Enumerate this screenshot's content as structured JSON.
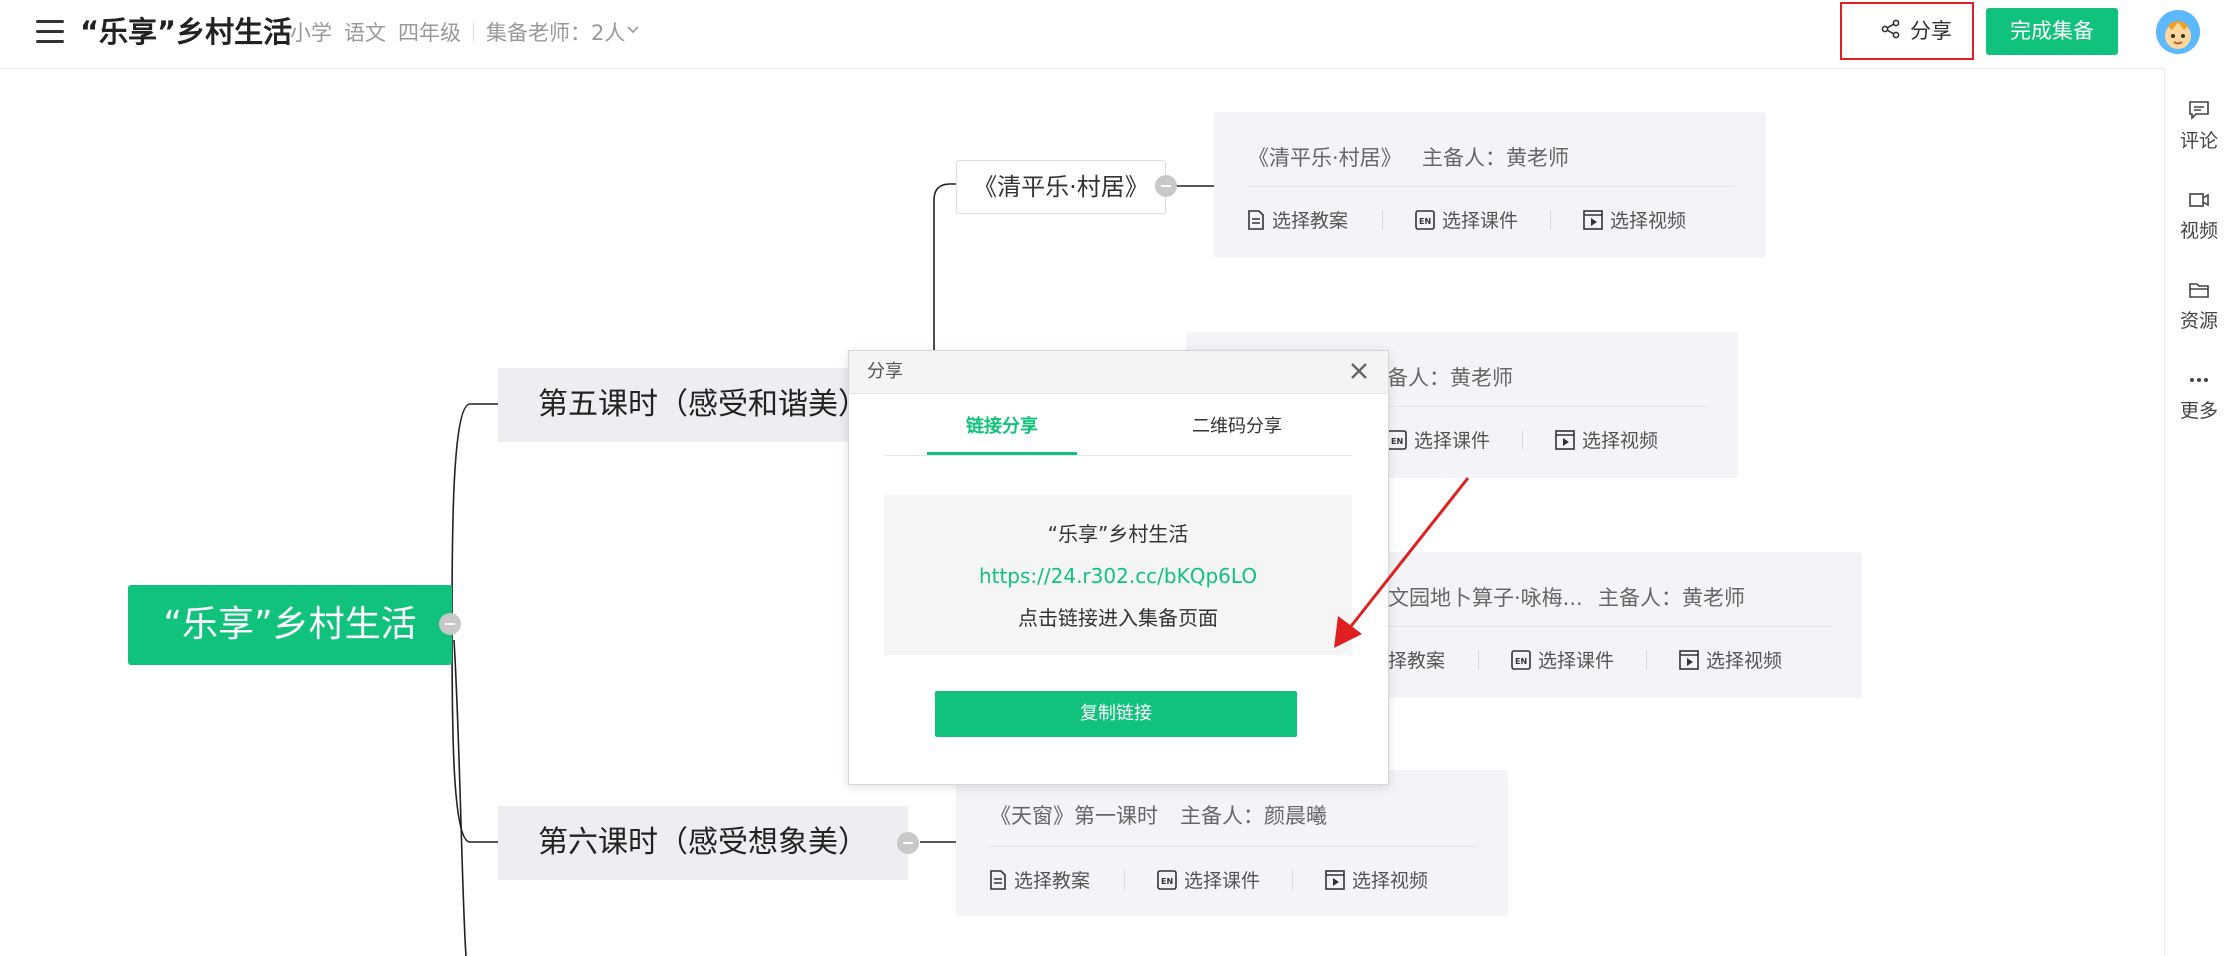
{
  "header": {
    "title": "“乐享”乡村生活",
    "stage": "小学",
    "subject": "语文",
    "grade": "四年级",
    "teachers": "集备老师：2人",
    "share_label": "分享",
    "done_label": "完成集备"
  },
  "rail": {
    "items": [
      {
        "label": "评论",
        "icon": "comment-icon"
      },
      {
        "label": "视频",
        "icon": "video-icon"
      },
      {
        "label": "资源",
        "icon": "folder-icon"
      },
      {
        "label": "更多",
        "icon": "more-icon"
      }
    ]
  },
  "mindmap": {
    "root": "“乐享”乡村生活",
    "lessons": [
      {
        "label": "第五课时（感受和谐美）"
      },
      {
        "label": "第六课时（感受想象美）"
      }
    ],
    "subnodes": [
      {
        "label": "《清平乐·村居》"
      }
    ],
    "cards": [
      {
        "title": "《清平乐·村居》",
        "owner": "主备人：黄老师"
      },
      {
        "title": "",
        "owner": "主备人：黄老师"
      },
      {
        "title": "文园地卜算子·咏梅...",
        "owner": "主备人：黄老师"
      },
      {
        "title": "《天窗》第一课时",
        "owner": "主备人：颜晨曦"
      }
    ],
    "actions": {
      "plan": "选择教案",
      "courseware": "选择课件",
      "video": "选择视频",
      "plan_partial": "择教案"
    }
  },
  "dialog": {
    "title": "分享",
    "tabs": [
      {
        "label": "链接分享",
        "active": true
      },
      {
        "label": "二维码分享",
        "active": false
      }
    ],
    "share_name": "“乐享”乡村生活",
    "link": "https://24.r302.cc/bKQp6LO",
    "hint": "点击链接进入集备页面",
    "copy_label": "复制链接"
  },
  "colors": {
    "accent": "#11c27d",
    "highlight_box": "#e02020",
    "arrow": "#e02020"
  }
}
